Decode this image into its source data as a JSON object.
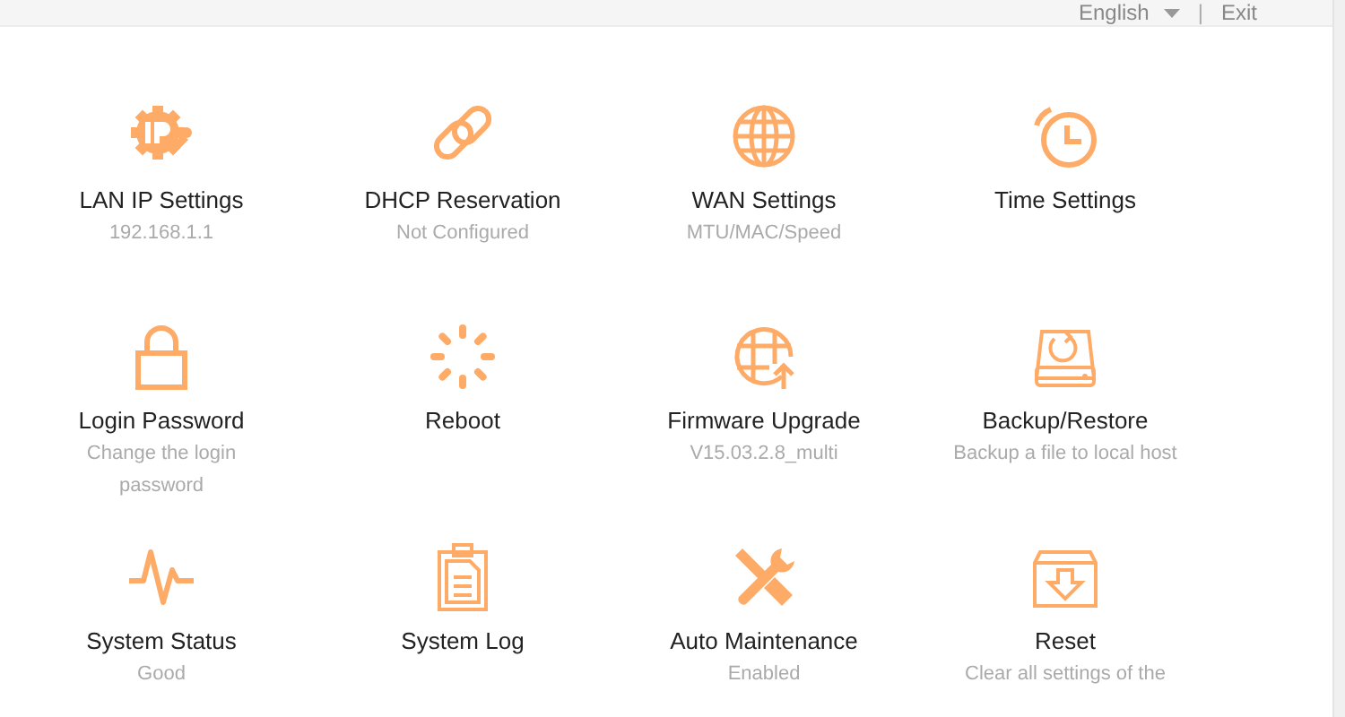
{
  "header": {
    "language": "English",
    "separator": "|",
    "exit": "Exit"
  },
  "items": [
    {
      "kind": "lan",
      "title": "LAN IP Settings",
      "subtitle": "192.168.1.1"
    },
    {
      "kind": "dhcp",
      "title": "DHCP Reservation",
      "subtitle": "Not Configured"
    },
    {
      "kind": "wan",
      "title": "WAN Settings",
      "subtitle": "MTU/MAC/Speed"
    },
    {
      "kind": "time",
      "title": "Time Settings"
    },
    {
      "kind": "password",
      "title": "Login Password",
      "subtitle": "Change the login password"
    },
    {
      "kind": "reboot",
      "title": "Reboot"
    },
    {
      "kind": "firmware",
      "title": "Firmware Upgrade",
      "subtitle": "V15.03.2.8_multi"
    },
    {
      "kind": "backup",
      "title": "Backup/Restore",
      "subtitle": "Backup a file to local host"
    },
    {
      "kind": "status",
      "title": "System Status",
      "subtitle": "Good"
    },
    {
      "kind": "log",
      "title": "System Log"
    },
    {
      "kind": "maintenance",
      "title": "Auto Maintenance",
      "subtitle": "Enabled"
    },
    {
      "kind": "reset",
      "title": "Reset",
      "subtitle": "Clear all settings of the"
    }
  ]
}
